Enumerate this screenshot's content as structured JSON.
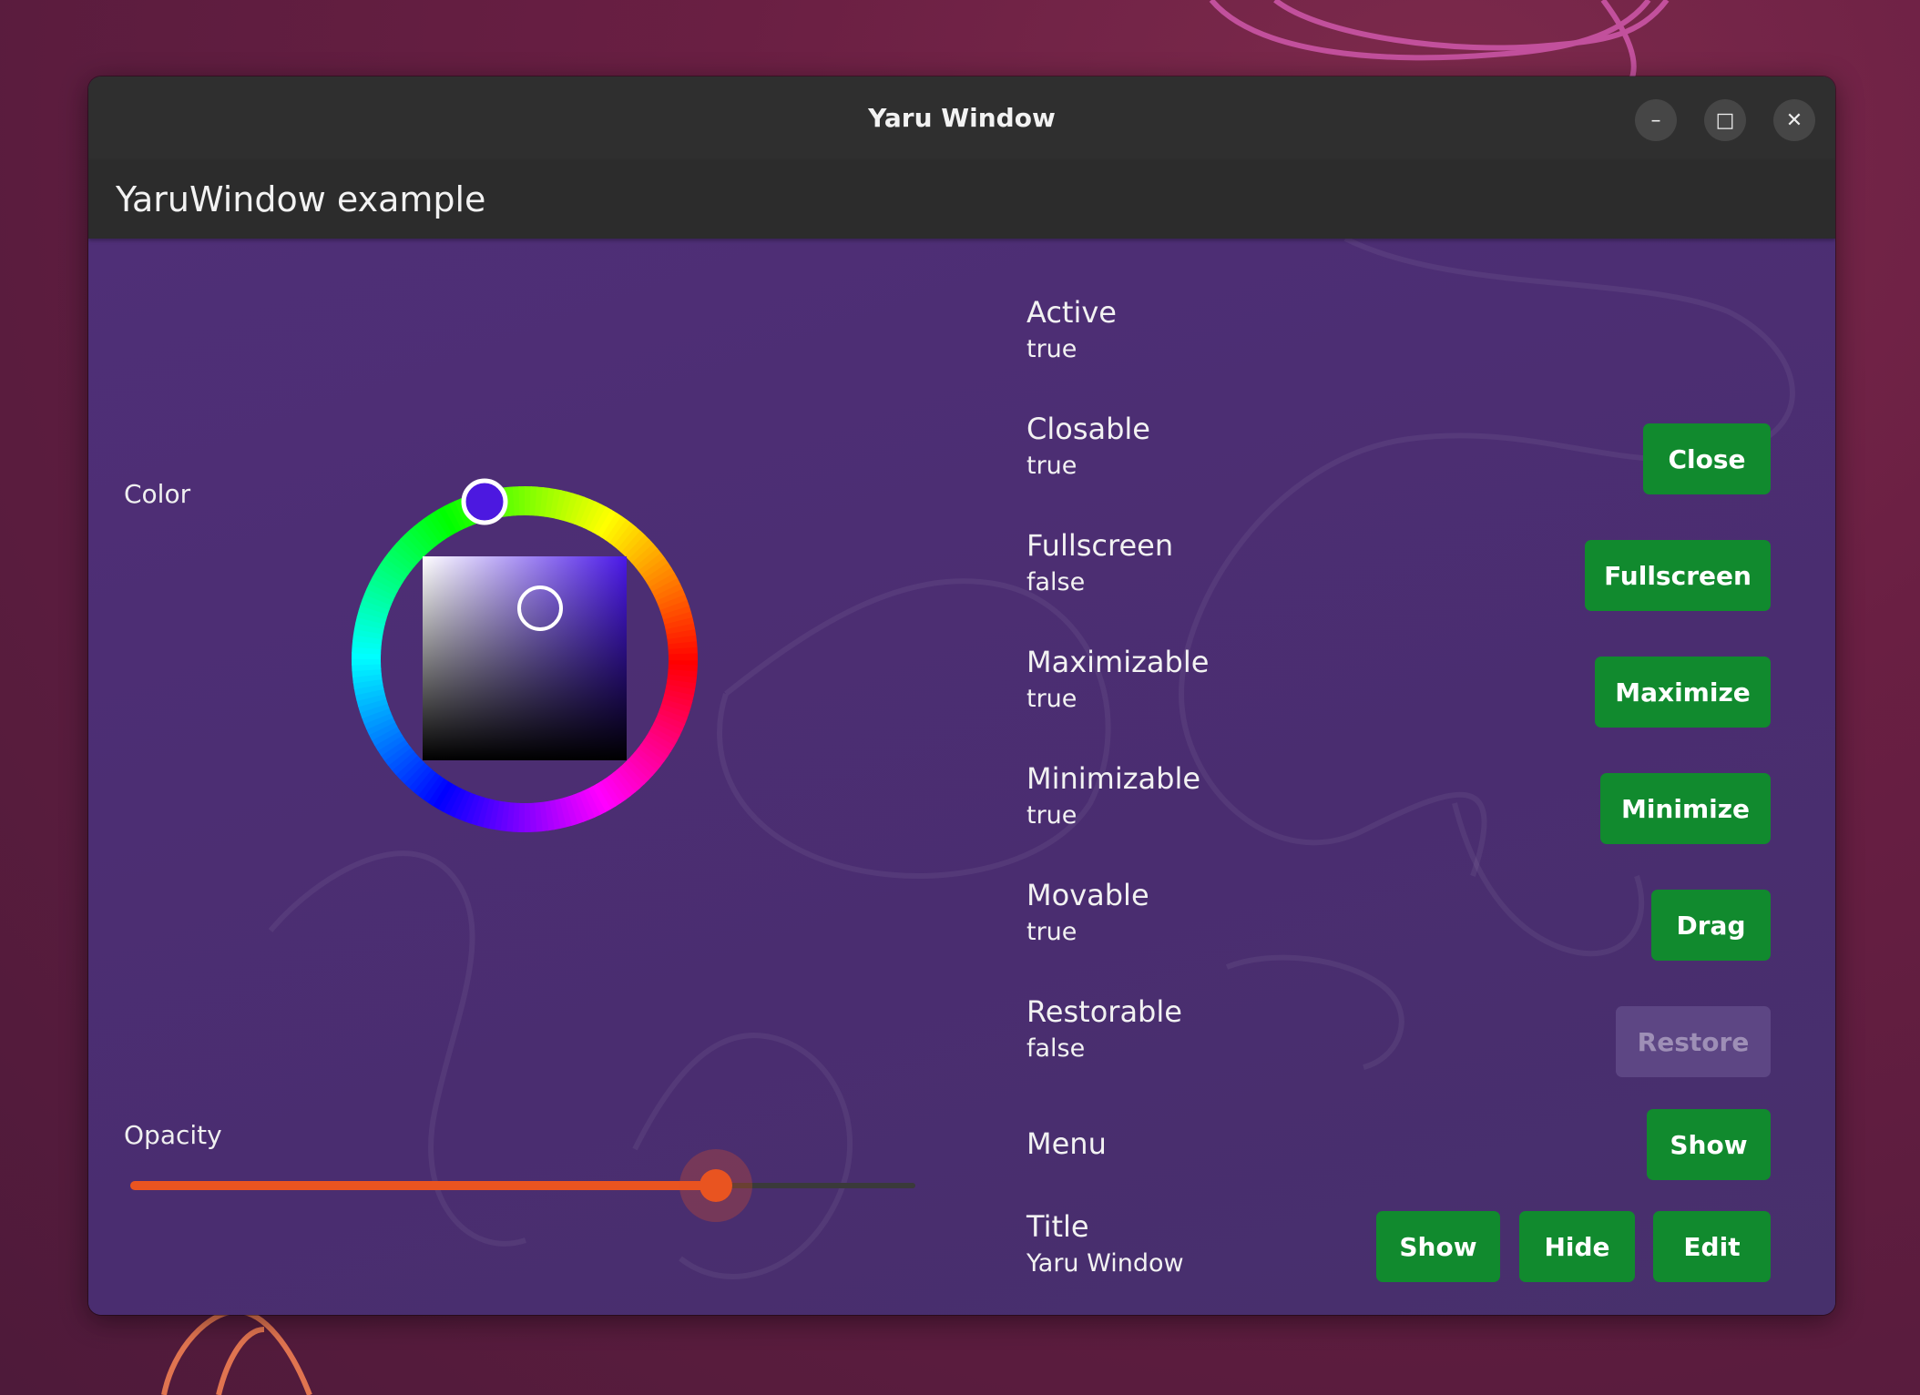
{
  "window": {
    "title": "Yaru Window",
    "controls": {
      "minimize": "–",
      "maximize": "□",
      "close": "✕"
    }
  },
  "appbar": {
    "title": "YaruWindow example"
  },
  "left": {
    "color_label": "Color",
    "opacity_label": "Opacity",
    "opacity_value": 0.86,
    "accent": "#e95420"
  },
  "properties": [
    {
      "name": "Active",
      "value": "true"
    },
    {
      "name": "Closable",
      "value": "true",
      "buttons": [
        "Close"
      ]
    },
    {
      "name": "Fullscreen",
      "value": "false",
      "buttons": [
        "Fullscreen"
      ]
    },
    {
      "name": "Maximizable",
      "value": "true",
      "buttons": [
        "Maximize"
      ]
    },
    {
      "name": "Minimizable",
      "value": "true",
      "buttons": [
        "Minimize"
      ]
    },
    {
      "name": "Movable",
      "value": "true",
      "buttons": [
        "Drag"
      ]
    },
    {
      "name": "Restorable",
      "value": "false",
      "buttons": [
        "Restore"
      ],
      "disabled": true
    },
    {
      "name": "Menu",
      "value": "",
      "buttons": [
        "Show"
      ]
    },
    {
      "name": "Title",
      "value": "Yaru Window",
      "buttons": [
        "Show",
        "Hide",
        "Edit"
      ]
    }
  ],
  "colors": {
    "button": "#118a2e",
    "content_bg": "#4b2e72",
    "titlebar": "#2f2f2f"
  }
}
